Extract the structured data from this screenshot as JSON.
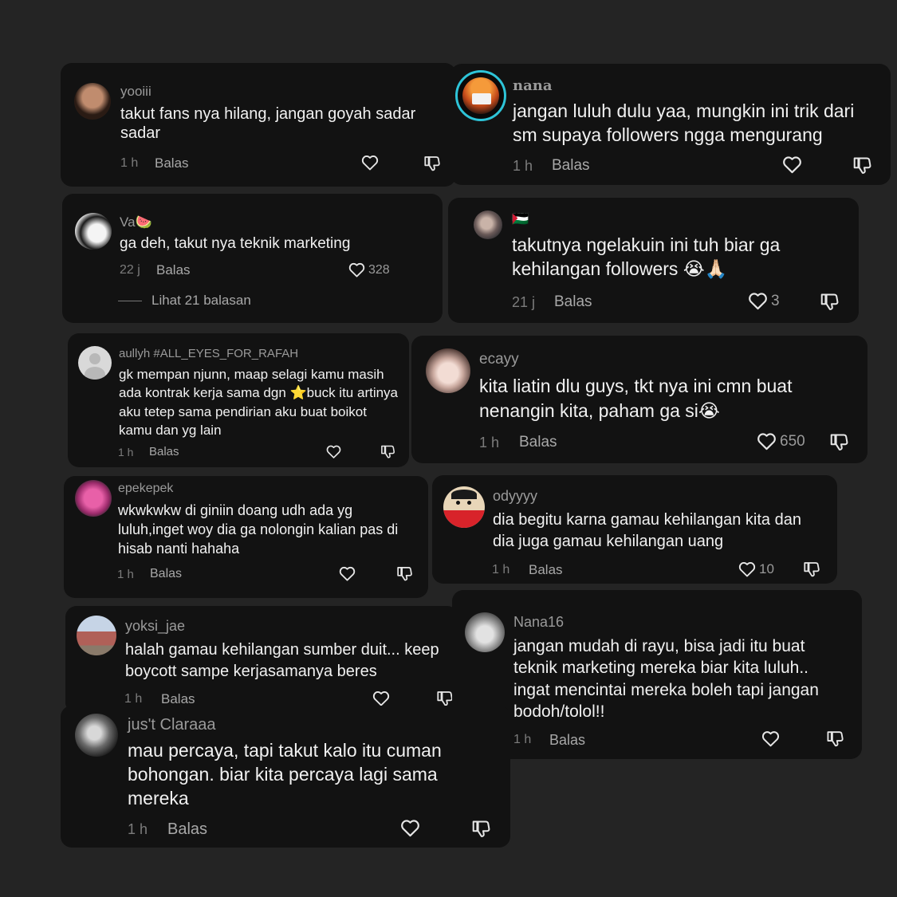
{
  "comments": [
    {
      "username": "yooiii",
      "text": "takut fans nya hilang, jangan goyah sadar sadar",
      "time": "1 h",
      "reply": "Balas",
      "likes": ""
    },
    {
      "username": "nana",
      "text": "jangan luluh dulu yaa, mungkin ini trik dari sm supaya followers ngga mengurang",
      "time": "1 h",
      "reply": "Balas",
      "likes": ""
    },
    {
      "username": "Va🍉",
      "text": "ga deh, takut nya teknik marketing",
      "time": "22 j",
      "reply": "Balas",
      "likes": "328",
      "view_replies": "Lihat 21 balasan"
    },
    {
      "username": "🇵🇸",
      "text": "takutnya ngelakuin ini tuh biar ga kehilangan followers 😭🙏🏻",
      "time": "21 j",
      "reply": "Balas",
      "likes": "3"
    },
    {
      "username": "aullyh #ALL_EYES_FOR_RAFAH",
      "text": "gk mempan njunn, maap selagi kamu masih ada kontrak kerja sama dgn ⭐️buck itu artinya aku tetep sama pendirian aku buat boikot kamu dan yg lain",
      "time": "1 h",
      "reply": "Balas",
      "likes": ""
    },
    {
      "username": "ecayy",
      "text": "kita liatin dlu guys, tkt nya ini cmn buat nenangin kita, paham ga si😭",
      "time": "1 h",
      "reply": "Balas",
      "likes": "650"
    },
    {
      "username": "epekepek",
      "text": "wkwkwkw di giniin doang udh ada yg luluh,inget woy dia ga nolongin kalian pas di hisab nanti hahaha",
      "time": "1 h",
      "reply": "Balas",
      "likes": ""
    },
    {
      "username": "odyyyy",
      "text": "dia begitu karna gamau kehilangan kita dan dia juga gamau kehilangan uang",
      "time": "1 h",
      "reply": "Balas",
      "likes": "10"
    },
    {
      "username": "yoksi_jae",
      "text": "halah gamau kehilangan sumber duit... keep boycott sampe kerjasamanya beres",
      "time": "1 h",
      "reply": "Balas",
      "likes": ""
    },
    {
      "username": "Nana16",
      "text": "jangan mudah di rayu, bisa jadi itu buat teknik marketing mereka biar kita luluh.. ingat mencintai mereka boleh tapi jangan bodoh/tolol!!",
      "time": "1 h",
      "reply": "Balas",
      "likes": ""
    },
    {
      "username": "jus't Claraaa",
      "text": "mau percaya, tapi takut kalo itu cuman bohongan. biar kita percaya lagi sama mereka",
      "time": "1 h",
      "reply": "Balas",
      "likes": ""
    }
  ],
  "icons": {
    "like": "heart-outline-icon",
    "dislike": "thumbs-down-icon"
  },
  "colors": {
    "background": "#242424",
    "card": "#121212",
    "text": "#f1f1f1",
    "muted": "#9a9a9a"
  }
}
